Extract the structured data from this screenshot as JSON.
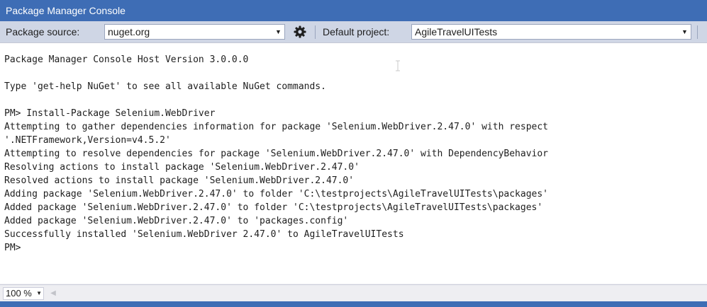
{
  "window": {
    "title": "Package Manager Console"
  },
  "toolbar": {
    "package_source_label": "Package source:",
    "package_source_value": "nuget.org",
    "settings_icon": "gear-icon",
    "default_project_label": "Default project:",
    "default_project_value": "AgileTravelUITests"
  },
  "console": {
    "lines": [
      "Package Manager Console Host Version 3.0.0.0",
      "",
      "Type 'get-help NuGet' to see all available NuGet commands.",
      "",
      "PM> Install-Package Selenium.WebDriver",
      "Attempting to gather dependencies information for package 'Selenium.WebDriver.2.47.0' with respect",
      "'.NETFramework,Version=v4.5.2'",
      "Attempting to resolve dependencies for package 'Selenium.WebDriver.2.47.0' with DependencyBehavior",
      "Resolving actions to install package 'Selenium.WebDriver.2.47.0'",
      "Resolved actions to install package 'Selenium.WebDriver.2.47.0'",
      "Adding package 'Selenium.WebDriver.2.47.0' to folder 'C:\\testprojects\\AgileTravelUITests\\packages'",
      "Added package 'Selenium.WebDriver.2.47.0' to folder 'C:\\testprojects\\AgileTravelUITests\\packages'",
      "Added package 'Selenium.WebDriver.2.47.0' to 'packages.config'",
      "Successfully installed 'Selenium.WebDriver 2.47.0' to AgileTravelUITests",
      "PM>"
    ]
  },
  "status": {
    "zoom": "100 %"
  },
  "colors": {
    "title_bar": "#3e6db5",
    "toolbar": "#cfd6e5",
    "console_bg": "#ffffff",
    "text": "#1e1e1e"
  }
}
